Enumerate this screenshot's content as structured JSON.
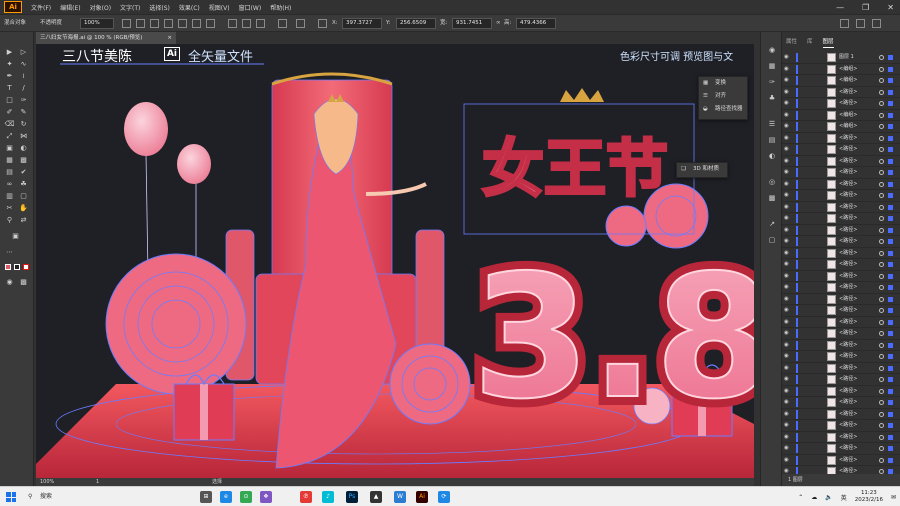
{
  "app": {
    "logo": "Ai",
    "menu": [
      "文件(F)",
      "编辑(E)",
      "对象(O)",
      "文字(T)",
      "选择(S)",
      "效果(C)",
      "视图(V)",
      "窗口(W)",
      "帮助(H)"
    ],
    "window_buttons": [
      "—",
      "❐",
      "✕"
    ]
  },
  "control_bar": {
    "mode_label": "混合对象",
    "opacity_label": "不透明度",
    "opacity_value": "100%",
    "x_label": "X:",
    "x_value": "397.3727",
    "y_label": "Y:",
    "y_value": "256.6509",
    "w_label": "宽:",
    "w_value": "931.7451",
    "h_label": "高:",
    "h_value": "479.4366"
  },
  "document_tab": {
    "title": "三八妇女节海报.ai @ 100 % (RGB/预览)",
    "close": "×"
  },
  "artwork": {
    "header_left": "三八节美陈",
    "ai_badge": "Ai",
    "header_vector": "全矢量文件",
    "header_right": "色彩尺寸可调   预览图与文",
    "title_chars": "女王节",
    "big_number": "3.8",
    "colors": {
      "background": "#1e2026",
      "pink": "#f07a9a",
      "deep_red": "#d93a4e",
      "light_pink": "#f7b3c4",
      "selection_blue": "#4a6bff",
      "gold": "#d8a440"
    }
  },
  "floating_panel_1": {
    "items": [
      "变换",
      "对齐",
      "路径查找器"
    ]
  },
  "floating_panel_2": {
    "items": [
      "3D 和材质"
    ]
  },
  "status_bar": {
    "zoom": "100%",
    "page": "1",
    "tool": "选择"
  },
  "layers_panel": {
    "tabs": [
      "属性",
      "库",
      "图层"
    ],
    "active_tab": "图层",
    "rows": [
      {
        "name": "图层 1"
      },
      {
        "name": "<编组>"
      },
      {
        "name": "<编组>"
      },
      {
        "name": "<路径>"
      },
      {
        "name": "<路径>"
      },
      {
        "name": "<编组>"
      },
      {
        "name": "<编组>"
      },
      {
        "name": "<路径>"
      },
      {
        "name": "<路径>"
      },
      {
        "name": "<路径>"
      },
      {
        "name": "<路径>"
      },
      {
        "name": "<路径>"
      },
      {
        "name": "<路径>"
      },
      {
        "name": "<路径>"
      },
      {
        "name": "<路径>"
      },
      {
        "name": "<路径>"
      },
      {
        "name": "<路径>"
      },
      {
        "name": "<路径>"
      },
      {
        "name": "<路径>"
      },
      {
        "name": "<路径>"
      },
      {
        "name": "<路径>"
      },
      {
        "name": "<路径>"
      },
      {
        "name": "<路径>"
      },
      {
        "name": "<路径>"
      },
      {
        "name": "<路径>"
      },
      {
        "name": "<路径>"
      },
      {
        "name": "<路径>"
      },
      {
        "name": "<路径>"
      },
      {
        "name": "<路径>"
      },
      {
        "name": "<路径>"
      },
      {
        "name": "<路径>"
      },
      {
        "name": "<路径>"
      },
      {
        "name": "<路径>"
      },
      {
        "name": "<路径>"
      },
      {
        "name": "<路径>"
      },
      {
        "name": "<路径>"
      },
      {
        "name": "<路径>"
      }
    ],
    "footer": "1 图层"
  },
  "taskbar": {
    "search_placeholder": "搜索",
    "apps": [
      "⊞",
      "e",
      "⊙",
      "❖",
      "℗",
      "♪",
      "Ps",
      "▲",
      "W",
      "Ai",
      "⟳"
    ],
    "tray_ime": "英",
    "time": "11:23",
    "date": "2023/2/16"
  }
}
